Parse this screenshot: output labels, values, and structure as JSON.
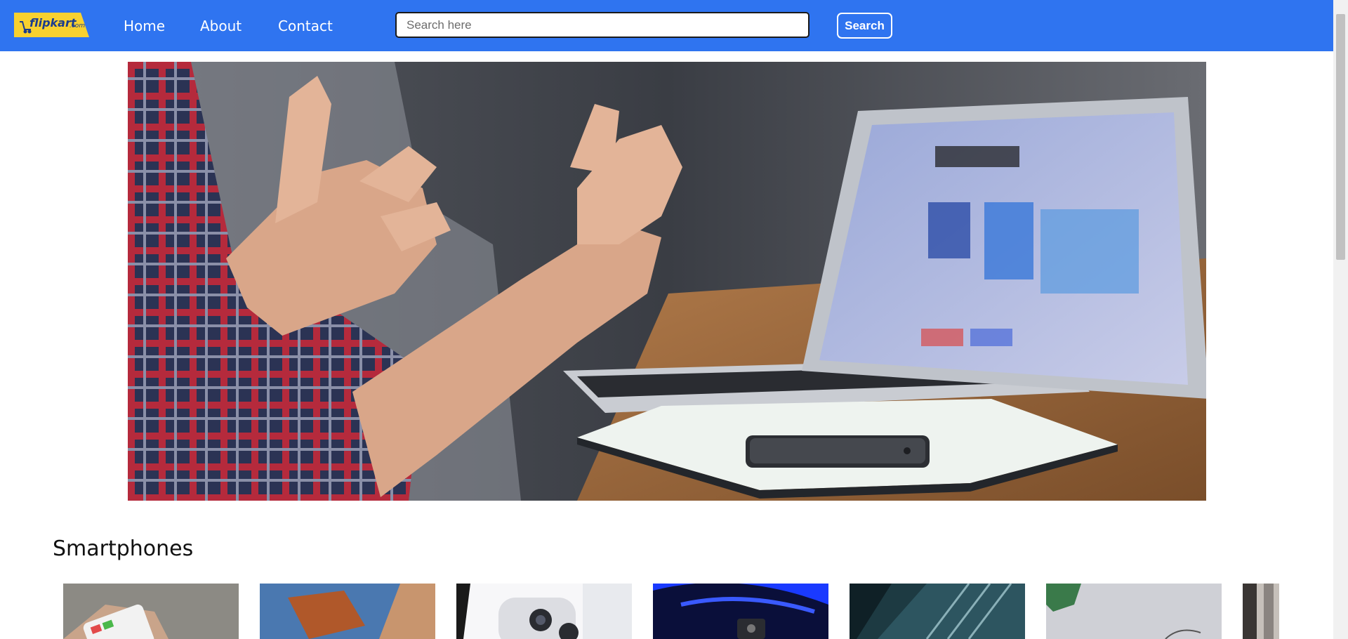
{
  "navbar": {
    "logo_text": "flipkart",
    "logo_suffix": ".com",
    "links": [
      "Home",
      "About",
      "Contact"
    ],
    "search": {
      "placeholder": "Search here",
      "value": ""
    },
    "search_button_label": "Search"
  },
  "colors": {
    "navbar": "#2f74f0",
    "logo_bg": "#f8d12f",
    "logo_text": "#1a3c8f"
  },
  "hero": {
    "image": "hands-gesturing-laptop-phone-notebook-desk"
  },
  "sections": [
    {
      "title": "Smartphones",
      "cards": [
        "phone-in-hand",
        "phone-case-art",
        "iphone-camera",
        "phone-blue-light",
        "phone-diagonal",
        "phone-white-desk",
        "phone-partial"
      ]
    }
  ]
}
